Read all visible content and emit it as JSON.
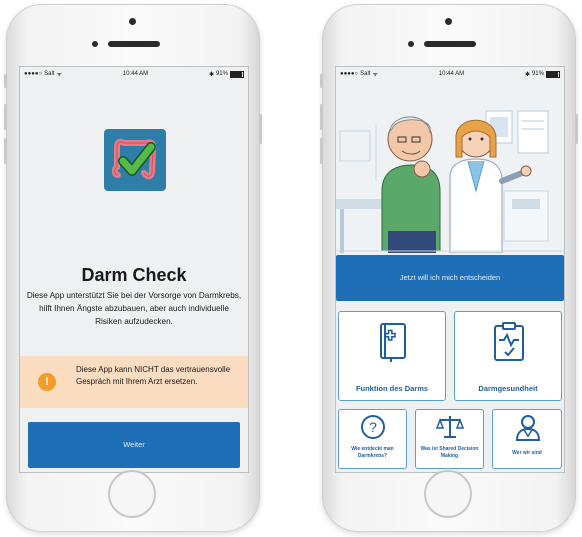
{
  "left_phone": {
    "status": {
      "carrier": "Salt",
      "time": "10:44 AM",
      "battery": "91%"
    },
    "app_title": "Darm Check",
    "description": "Diese App unterstützt Sie bei der Vorsorge von Darmkrebs, hilft Ihnen Ängste abzubauen, aber auch individuelle Risiken aufzudecken.",
    "warning": {
      "icon": "exclamation-icon",
      "text": "Diese App kann NICHT das vertrauensvolle Gespräch mit Ihrem Arzt ersetzen."
    },
    "next_button": "Weiter"
  },
  "right_phone": {
    "status": {
      "carrier": "Salt",
      "time": "10:44 AM",
      "battery": "91%"
    },
    "decide_button": "Jetzt will ich mich entscheiden",
    "tiles": [
      {
        "label": "Funktion des Darms",
        "icon": "medical-book-icon"
      },
      {
        "label": "Darmgesundheit",
        "icon": "clipboard-health-icon"
      }
    ],
    "small_tiles": [
      {
        "label": "Wie entdeckt man Darmkrebs?",
        "icon": "question-icon"
      },
      {
        "label": "Was ist Shared Decision Making",
        "icon": "scale-icon"
      },
      {
        "label": "Wer wir sind",
        "icon": "doctor-icon"
      }
    ]
  },
  "colors": {
    "primary": "#1f6fb7",
    "warning_bg": "#fadcc0",
    "warning_icon": "#f39c2a",
    "icon_bg": "#2f7ea8",
    "check": "#58b947"
  }
}
